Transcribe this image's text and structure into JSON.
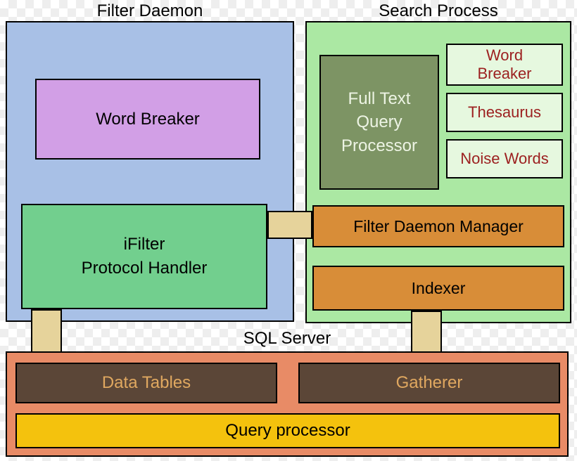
{
  "filterDaemon": {
    "title": "Filter Daemon",
    "wordBreaker": "Word Breaker",
    "ifilter": "iFilter\nProtocol Handler"
  },
  "searchProcess": {
    "title": "Search Process",
    "fullText": "Full Text\nQuery\nProcessor",
    "wordBreaker": "Word\nBreaker",
    "thesaurus": "Thesaurus",
    "noiseWords": "Noise Words",
    "filterDaemonManager": "Filter Daemon Manager",
    "indexer": "Indexer"
  },
  "sqlServer": {
    "title": "SQL Server",
    "dataTables": "Data Tables",
    "gatherer": "Gatherer",
    "queryProcessor": "Query processor"
  }
}
